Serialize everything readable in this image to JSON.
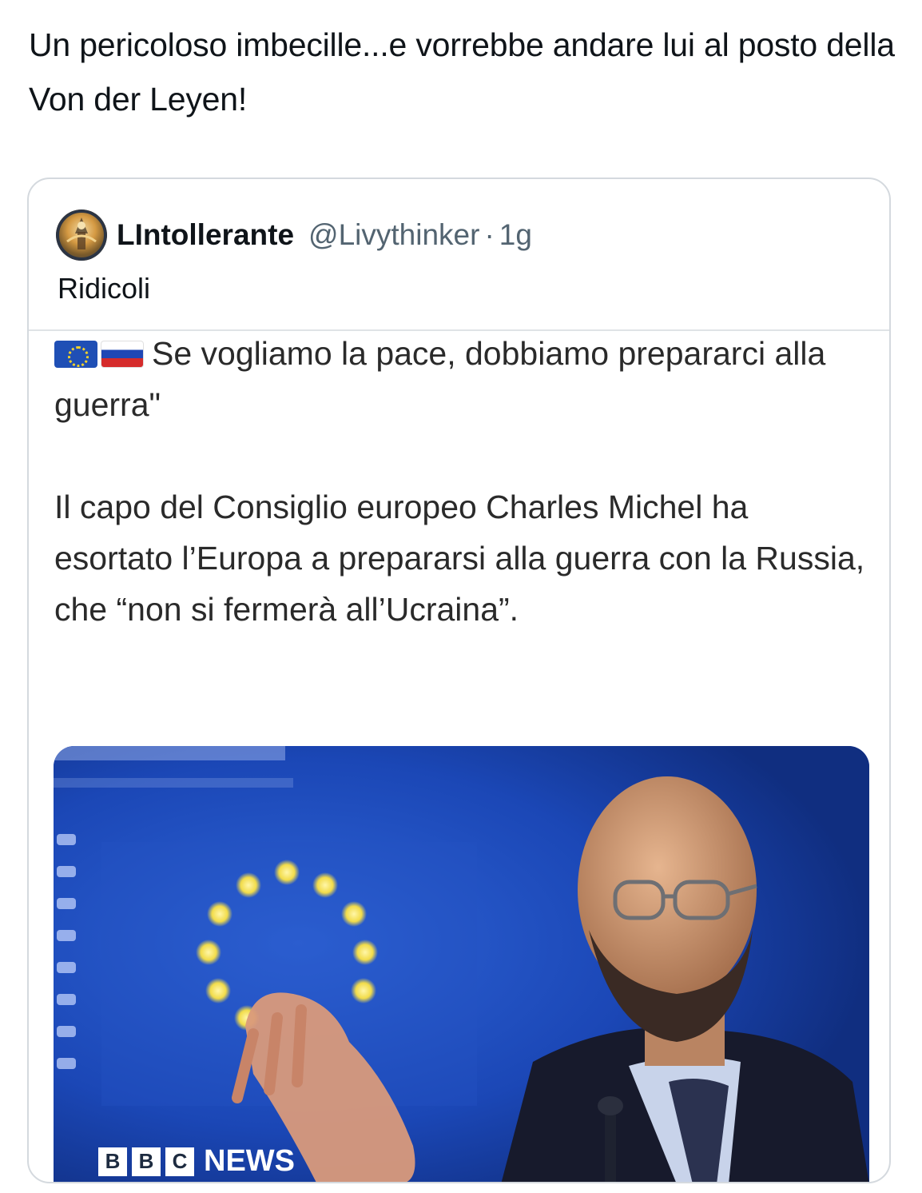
{
  "post": {
    "text": "Un pericoloso imbecille...e vorrebbe andare lui al posto della Von der Leyen!"
  },
  "quoted_post": {
    "display_name": "LIntollerante",
    "handle": "@Livythinker",
    "separator": "·",
    "time": "1g",
    "text": "Ridicoli",
    "avatar_icon": "avatar-icon"
  },
  "embedded_post": {
    "flags": [
      "eu-flag-icon",
      "russia-flag-icon"
    ],
    "headline": "Se vogliamo la pace, dobbiamo prepararci alla guerra\"",
    "body": "Il capo del Consiglio europeo Charles Michel ha esortato l’Europa a prepararsi alla guerra con la Russia, che “non si fermerà all’Ucraina”."
  },
  "image": {
    "brand_letters": [
      "B",
      "B",
      "C"
    ],
    "brand_word": "NEWS"
  },
  "colors": {
    "text": "#0f1419",
    "secondary": "#536471",
    "border": "#d4d9de",
    "eu_blue": "#1a44b8"
  }
}
